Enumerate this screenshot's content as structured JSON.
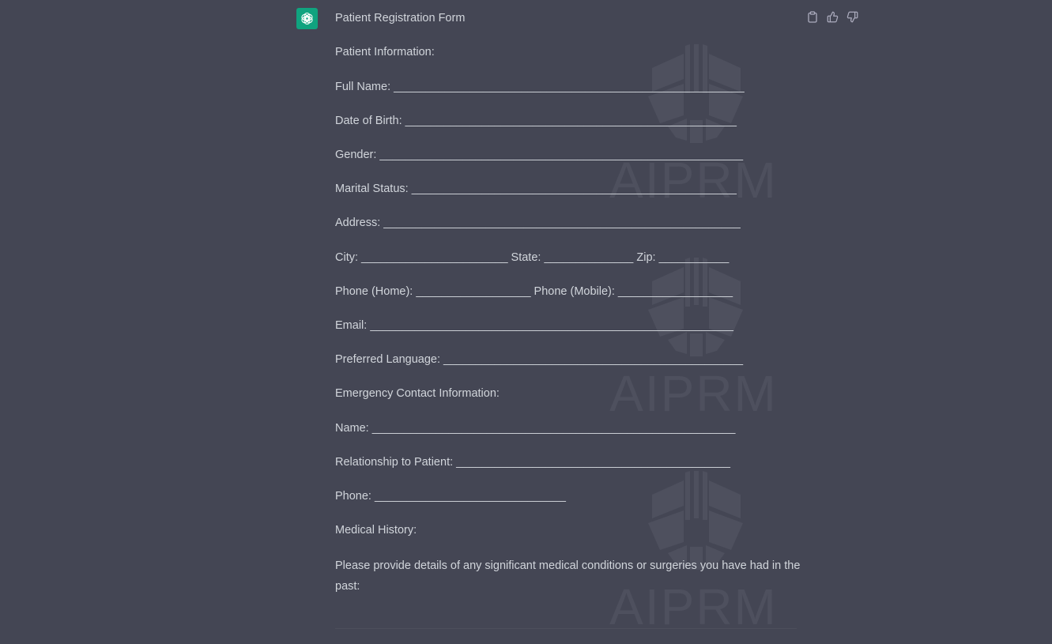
{
  "message": {
    "title": "Patient Registration Form",
    "lines": [
      "Patient Information:",
      "Full Name: _______________________________________________________",
      "Date of Birth: ____________________________________________________",
      "Gender: _________________________________________________________",
      "Marital Status: ___________________________________________________",
      "Address: ________________________________________________________",
      "City: _______________________ State: ______________ Zip: ___________",
      "Phone (Home): __________________ Phone (Mobile): __________________",
      "Email: _________________________________________________________",
      "Preferred Language: _______________________________________________",
      "Emergency Contact Information:",
      "Name: _________________________________________________________",
      "Relationship to Patient: ___________________________________________",
      "Phone: ______________________________",
      "Medical History:"
    ],
    "paragraph": "Please provide details of any significant medical conditions or surgeries you have had in the past:"
  },
  "watermark": {
    "text": "AIPRM"
  },
  "icons": {
    "avatar": "openai-logo-icon",
    "copy": "clipboard-icon",
    "like": "thumbs-up-icon",
    "dislike": "thumbs-down-icon"
  },
  "colors": {
    "background": "#444654",
    "text": "#d1d5db",
    "avatar": "#10a37f"
  }
}
